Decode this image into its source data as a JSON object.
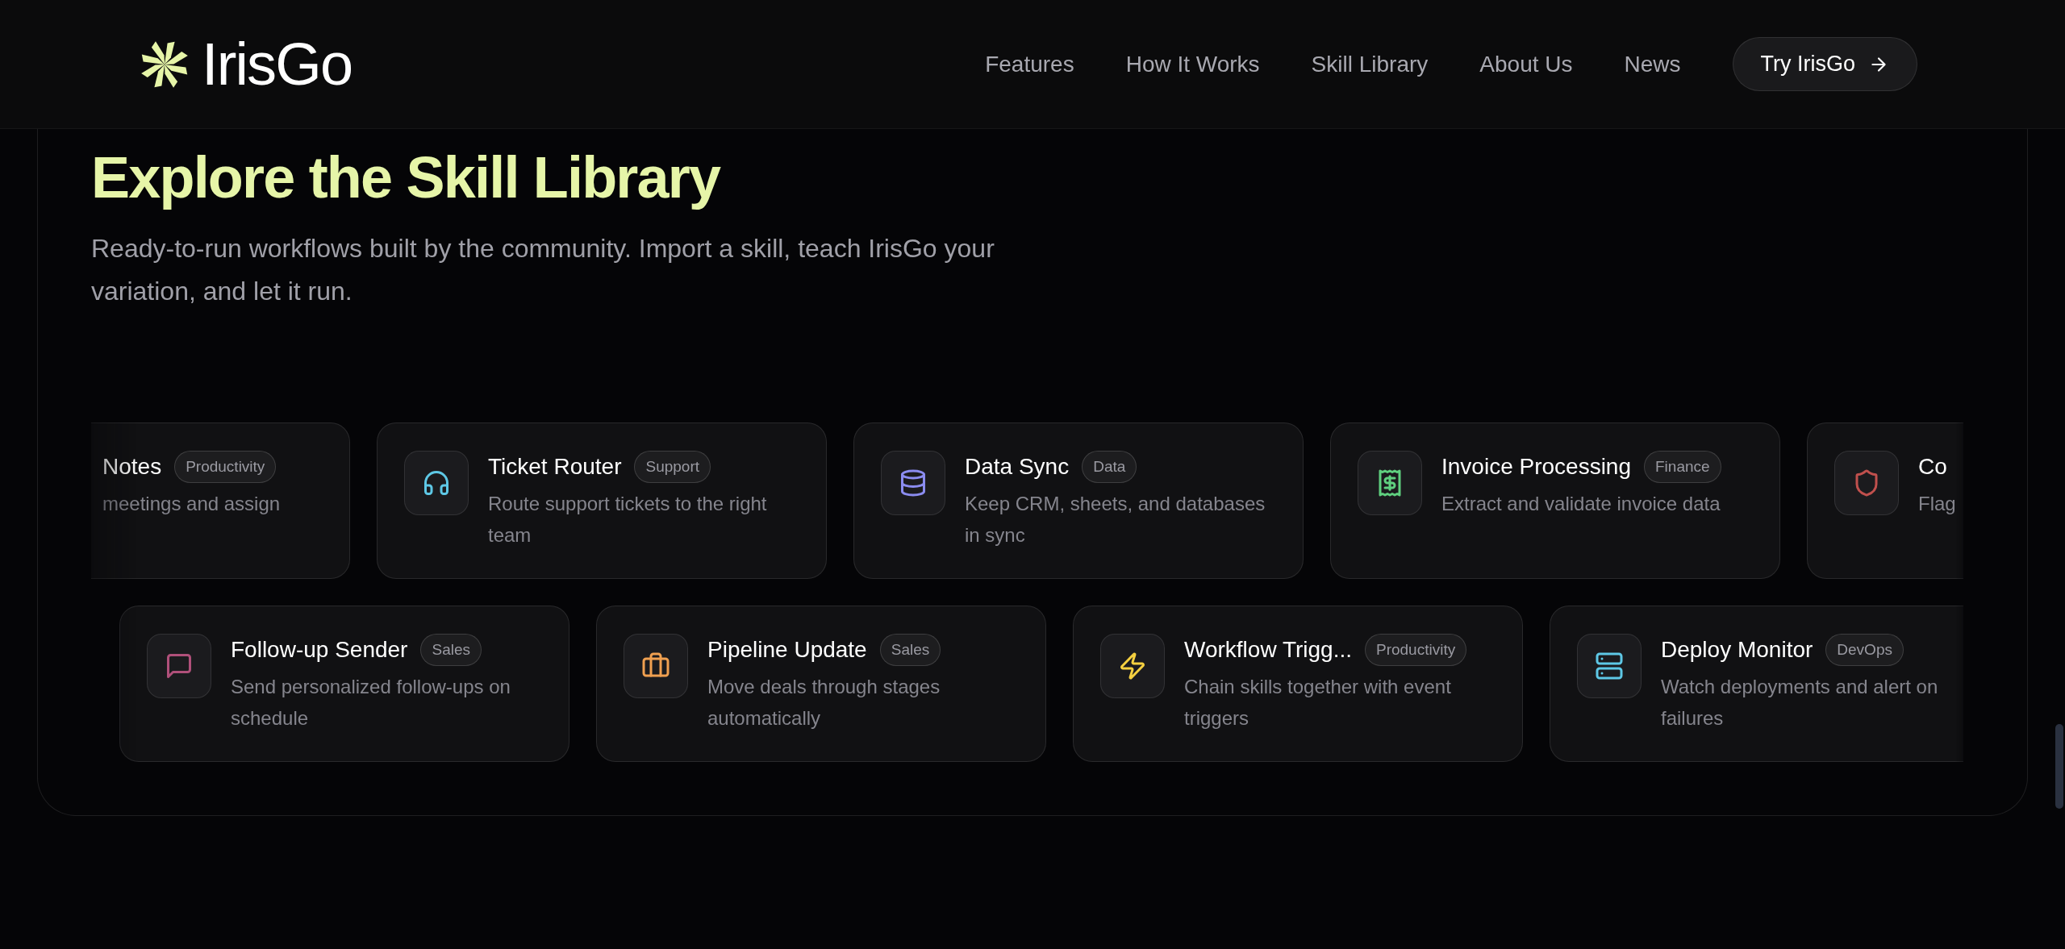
{
  "header": {
    "logo": "IrisGo",
    "nav": [
      {
        "label": "Features"
      },
      {
        "label": "How It Works"
      },
      {
        "label": "Skill Library"
      },
      {
        "label": "About Us"
      },
      {
        "label": "News"
      }
    ],
    "cta": "Try IrisGo"
  },
  "section": {
    "title": "Explore the Skill Library",
    "subtitle": "Ready-to-run workflows built by the community. Import a skill, teach IrisGo your variation, and let it run.",
    "rows": [
      [
        {
          "kind": "cut",
          "title": "Notes",
          "tag": "Productivity",
          "description": "meetings and assign"
        },
        {
          "kind": "headphones",
          "color": "#5ec8e6",
          "title": "Ticket Router",
          "tag": "Support",
          "description": "Route support tickets to the right team"
        },
        {
          "kind": "database",
          "color": "#8b8cf0",
          "title": "Data Sync",
          "tag": "Data",
          "description": "Keep CRM, sheets, and databases in sync"
        },
        {
          "kind": "receipt",
          "color": "#5fd07f",
          "title": "Invoice Processing",
          "tag": "Finance",
          "description": "Extract and validate invoice data"
        },
        {
          "kind": "shield",
          "color": "#c0504d",
          "title": "Co",
          "description": "Flag"
        }
      ],
      [
        {
          "kind": "message",
          "color": "#b0507a",
          "title": "Follow-up Sender",
          "tag": "Sales",
          "description": "Send personalized follow-ups on schedule"
        },
        {
          "kind": "briefcase",
          "color": "#f0a050",
          "title": "Pipeline Update",
          "tag": "Sales",
          "description": "Move deals through stages automatically"
        },
        {
          "kind": "zap",
          "color": "#f5d040",
          "title": "Workflow Trigg...",
          "tag": "Productivity",
          "description": "Chain skills together with event triggers"
        },
        {
          "kind": "server",
          "color": "#5ec8e6",
          "title": "Deploy Monitor",
          "tag": "DevOps",
          "description": "Watch deployments and alert on failures"
        }
      ]
    ]
  }
}
